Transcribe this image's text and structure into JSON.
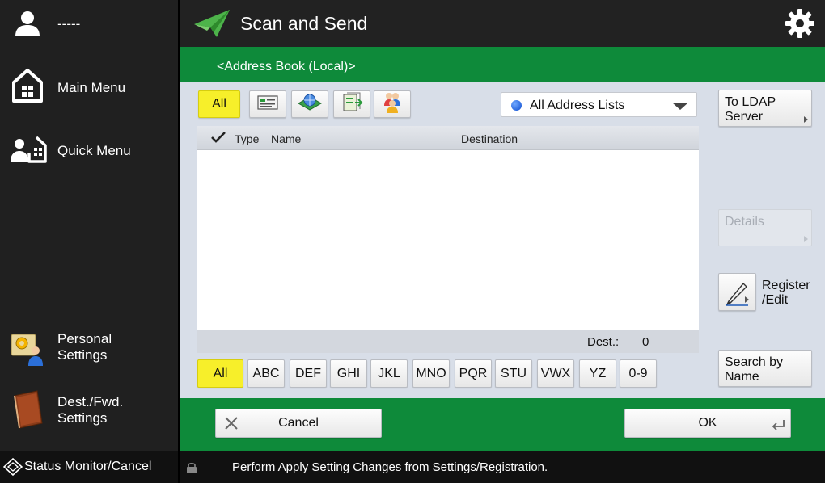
{
  "user": {
    "name": "-----"
  },
  "sidebar": {
    "main_menu": "Main Menu",
    "quick_menu": "Quick Menu",
    "personal_settings": [
      "Personal",
      "Settings"
    ],
    "dest_fwd_settings": [
      "Dest./Fwd.",
      "Settings"
    ]
  },
  "header": {
    "title": "Scan and Send"
  },
  "address_book": {
    "title": "<Address Book (Local)>"
  },
  "filters": {
    "all_label": "All",
    "type_icons": [
      "email-card-icon",
      "network-globe-icon",
      "file-server-icon",
      "group-people-icon"
    ]
  },
  "address_list_dropdown": {
    "selected": "All Address Lists"
  },
  "table": {
    "columns": {
      "type": "Type",
      "name": "Name",
      "destination": "Destination"
    },
    "rows": [],
    "footer": {
      "dest_label": "Dest.:",
      "dest_count": "0"
    }
  },
  "alpha_index": [
    "All",
    "ABC",
    "DEF",
    "GHI",
    "JKL",
    "MNO",
    "PQR",
    "STU",
    "VWX",
    "YZ",
    "0-9"
  ],
  "right_buttons": {
    "ldap": [
      "To LDAP",
      "Server"
    ],
    "details": "Details",
    "register": [
      "Register",
      "/Edit"
    ],
    "search": [
      "Search by",
      "Name"
    ]
  },
  "actions": {
    "cancel": "Cancel",
    "ok": "OK"
  },
  "status": {
    "monitor_label": "Status Monitor/Cancel",
    "message": "Perform Apply Setting Changes from Settings/Registration."
  },
  "colors": {
    "green": "#0e8a3a",
    "yellow_selected": "#f7ef2a",
    "panel_bg": "#d8dee8",
    "dark": "#202020"
  }
}
